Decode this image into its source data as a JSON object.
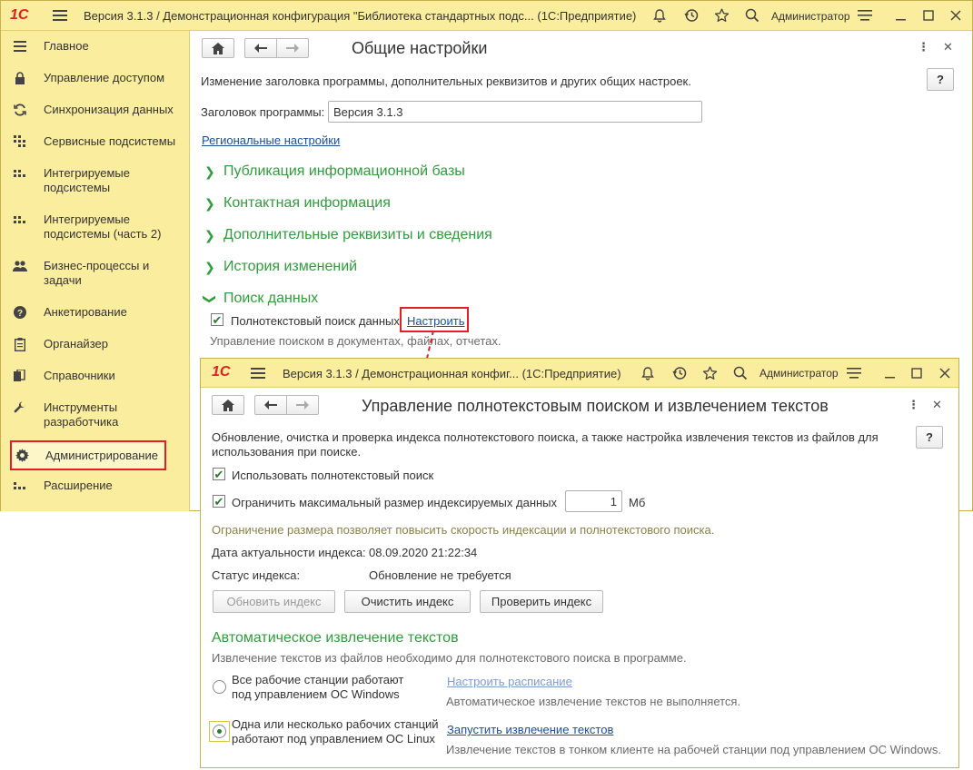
{
  "main": {
    "logo": "1С",
    "title": "Версия 3.1.3 / Демонстрационная конфигурация \"Библиотека стандартных подс...  (1С:Предприятие)",
    "user": "Администратор",
    "sidebar": {
      "items": [
        {
          "label": "Главное",
          "icon": "hamburger-icon"
        },
        {
          "label": "Управление доступом",
          "icon": "lock-icon"
        },
        {
          "label": "Синхронизация данных",
          "icon": "sync-icon"
        },
        {
          "label": "Сервисные подсистемы",
          "icon": "grid-icon"
        },
        {
          "label": "Интегрируемые подсистемы",
          "icon": "chart-icon"
        },
        {
          "label": "Интегрируемые подсистемы (часть 2)",
          "icon": "chart-icon"
        },
        {
          "label": "Бизнес-процессы и задачи",
          "icon": "people-icon"
        },
        {
          "label": "Анкетирование",
          "icon": "question-icon"
        },
        {
          "label": "Органайзер",
          "icon": "clipboard-icon"
        },
        {
          "label": "Справочники",
          "icon": "books-icon"
        },
        {
          "label": "Инструменты разработчика",
          "icon": "wrench-icon"
        },
        {
          "label": "Администрирование",
          "icon": "gear-icon"
        },
        {
          "label": "Расширение",
          "icon": "blocks-icon"
        }
      ]
    },
    "form": {
      "title": "Общие настройки",
      "description": "Изменение заголовка программы, дополнительных реквизитов и других общих настроек.",
      "help": "?",
      "caption_label": "Заголовок программы:",
      "caption_value": "Версия 3.1.3",
      "regional_link": "Региональные настройки",
      "groups": [
        "Публикация информационной базы",
        "Контактная информация",
        "Дополнительные реквизиты и сведения",
        "История изменений"
      ],
      "search_group": "Поиск данных",
      "fulltext_checkbox": "Полнотекстовый поиск данных",
      "configure_link": "Настроить",
      "search_hint": "Управление поиском в документах, файлах, отчетах."
    }
  },
  "popup": {
    "logo": "1С",
    "title": "Версия 3.1.3 / Демонстрационная конфиг...  (1С:Предприятие)",
    "user": "Администратор",
    "form_title": "Управление полнотекстовым поиском и извлечением текстов",
    "help": "?",
    "description": "Обновление, очистка и проверка индекса полнотекстового поиска, а также настройка извлечения текстов из файлов для использования при поиске.",
    "use_fulltext": "Использовать полнотекстовый поиск",
    "limit_size": "Ограничить максимальный размер индексируемых данных",
    "limit_value": "1",
    "limit_unit": "Мб",
    "limit_hint": "Ограничение размера позволяет повысить скорость индексации и полнотекстового поиска.",
    "actuality_label": "Дата актуальности индекса:",
    "actuality_value": "08.09.2020 21:22:34",
    "status_label": "Статус индекса:",
    "status_value": "Обновление не требуется",
    "buttons": {
      "update": "Обновить индекс",
      "clear": "Очистить индекс",
      "check": "Проверить индекс"
    },
    "auto_extract_title": "Автоматическое извлечение текстов",
    "auto_extract_hint": "Извлечение текстов из файлов необходимо для полнотекстового поиска в программе.",
    "option_windows": "Все рабочие станции работают под управлением ОС Windows",
    "schedule_link": "Настроить расписание",
    "schedule_hint": "Автоматическое извлечение текстов не выполняется.",
    "option_linux": "Одна или несколько рабочих станций работают под управлением ОС Linux",
    "run_link": "Запустить извлечение текстов",
    "run_hint": "Извлечение текстов в тонком клиенте на рабочей станции под управлением ОС Windows."
  },
  "colors": {
    "titlebar": "#fbed9e",
    "accent_green": "#2f9d3b",
    "highlight_red": "#e31e24",
    "link_blue": "#1b4e9b"
  }
}
